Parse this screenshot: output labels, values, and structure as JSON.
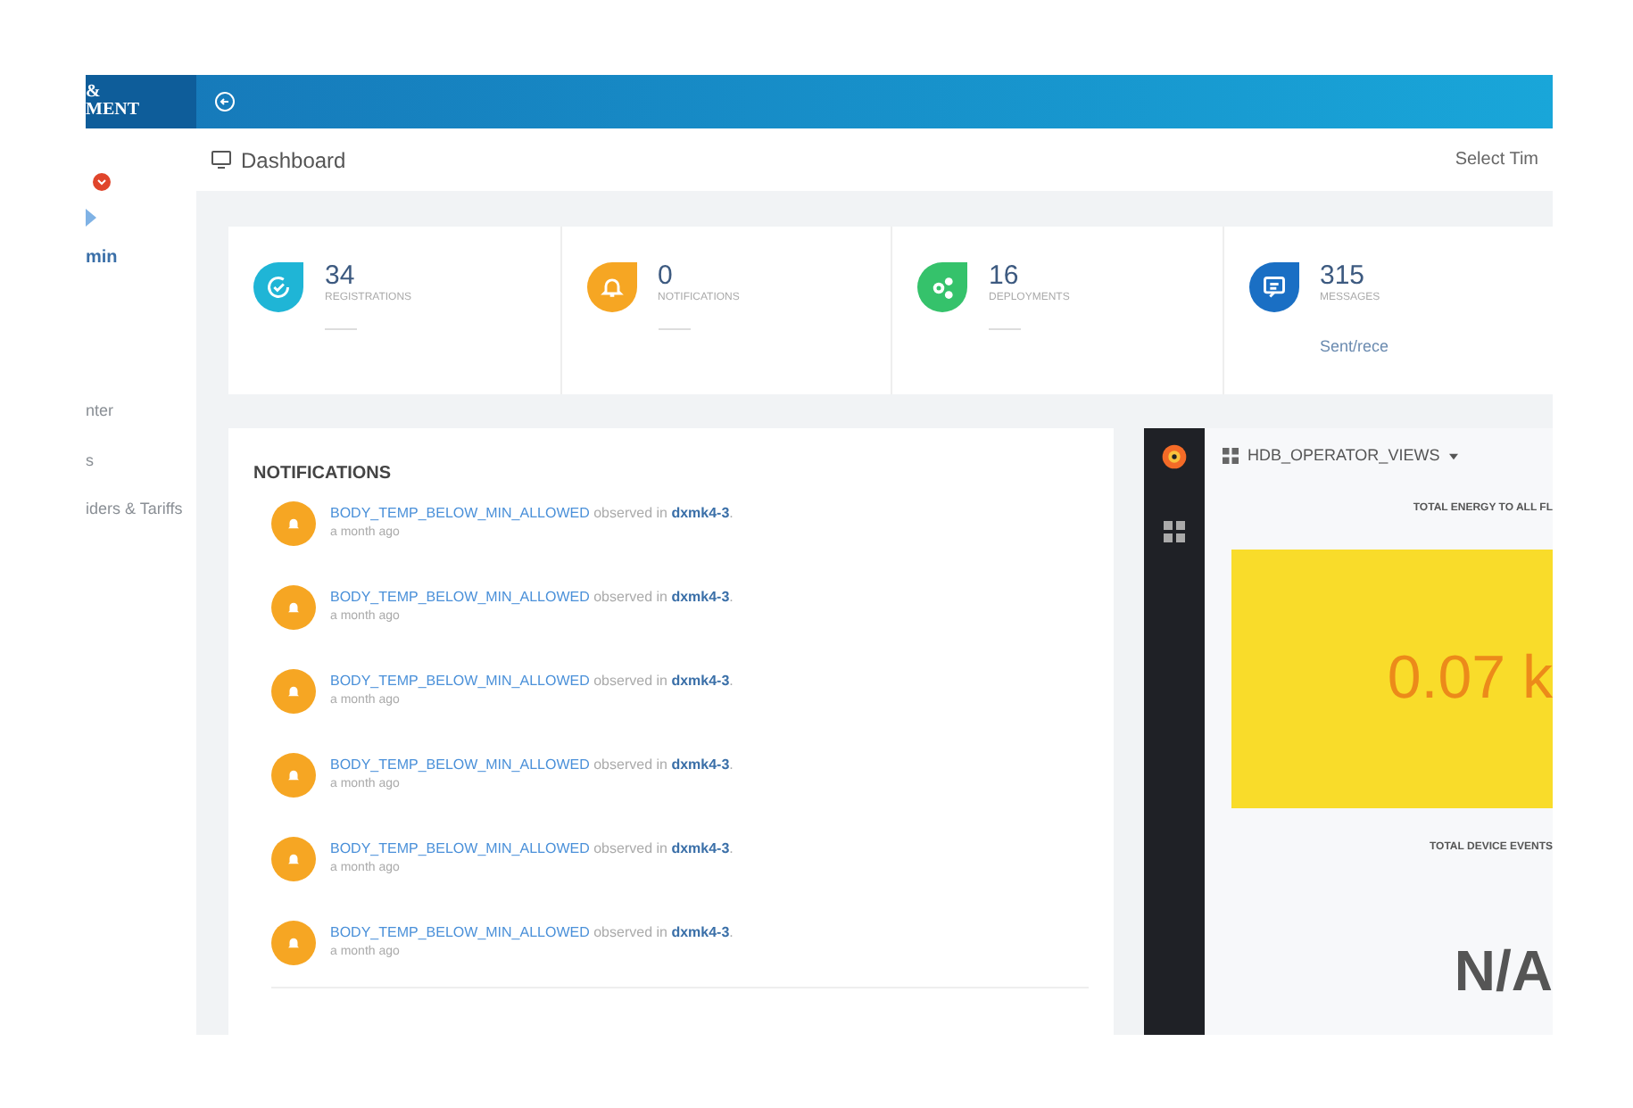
{
  "logo": {
    "lines": [
      "&",
      "MENT"
    ]
  },
  "sidebar": {
    "user_name": "min",
    "items": [
      {
        "label": "nter"
      },
      {
        "label": "s"
      },
      {
        "label": "iders & Tariffs"
      }
    ]
  },
  "header": {
    "title": "Dashboard",
    "time_selector": "Select Tim"
  },
  "stats": [
    {
      "kind": "registrations",
      "value": "34",
      "label": "REGISTRATIONS",
      "color": "#1fb5d6"
    },
    {
      "kind": "notifications",
      "value": "0",
      "label": "NOTIFICATIONS",
      "color": "#f6a623"
    },
    {
      "kind": "deployments",
      "value": "16",
      "label": "DEPLOYMENTS",
      "color": "#35c26b"
    },
    {
      "kind": "messages",
      "value": "315",
      "label": "MESSAGES",
      "color": "#1a6fc4",
      "footer": "Sent/rece"
    }
  ],
  "notifications": {
    "title": "NOTIFICATIONS",
    "items": [
      {
        "event": "BODY_TEMP_BELOW_MIN_ALLOWED",
        "text": "observed in",
        "device": "dxmk4-3",
        "suffix": ".",
        "time": "a month ago"
      },
      {
        "event": "BODY_TEMP_BELOW_MIN_ALLOWED",
        "text": "observed in",
        "device": "dxmk4-3",
        "suffix": ".",
        "time": "a month ago"
      },
      {
        "event": "BODY_TEMP_BELOW_MIN_ALLOWED",
        "text": "observed in",
        "device": "dxmk4-3",
        "suffix": ".",
        "time": "a month ago"
      },
      {
        "event": "BODY_TEMP_BELOW_MIN_ALLOWED",
        "text": "observed in",
        "device": "dxmk4-3",
        "suffix": ".",
        "time": "a month ago"
      },
      {
        "event": "BODY_TEMP_BELOW_MIN_ALLOWED",
        "text": "observed in",
        "device": "dxmk4-3",
        "suffix": ".",
        "time": "a month ago"
      },
      {
        "event": "BODY_TEMP_BELOW_MIN_ALLOWED",
        "text": "observed in",
        "device": "dxmk4-3",
        "suffix": ".",
        "time": "a month ago"
      }
    ]
  },
  "grafana": {
    "dashboard_title": "HDB_OPERATOR_VIEWS",
    "panels": [
      {
        "title": "TOTAL ENERGY TO ALL FL",
        "value": "0.07 k",
        "color": "#f9dc2a"
      },
      {
        "title": "TOTAL DEVICE EVENTS",
        "value": "N/A"
      }
    ]
  }
}
